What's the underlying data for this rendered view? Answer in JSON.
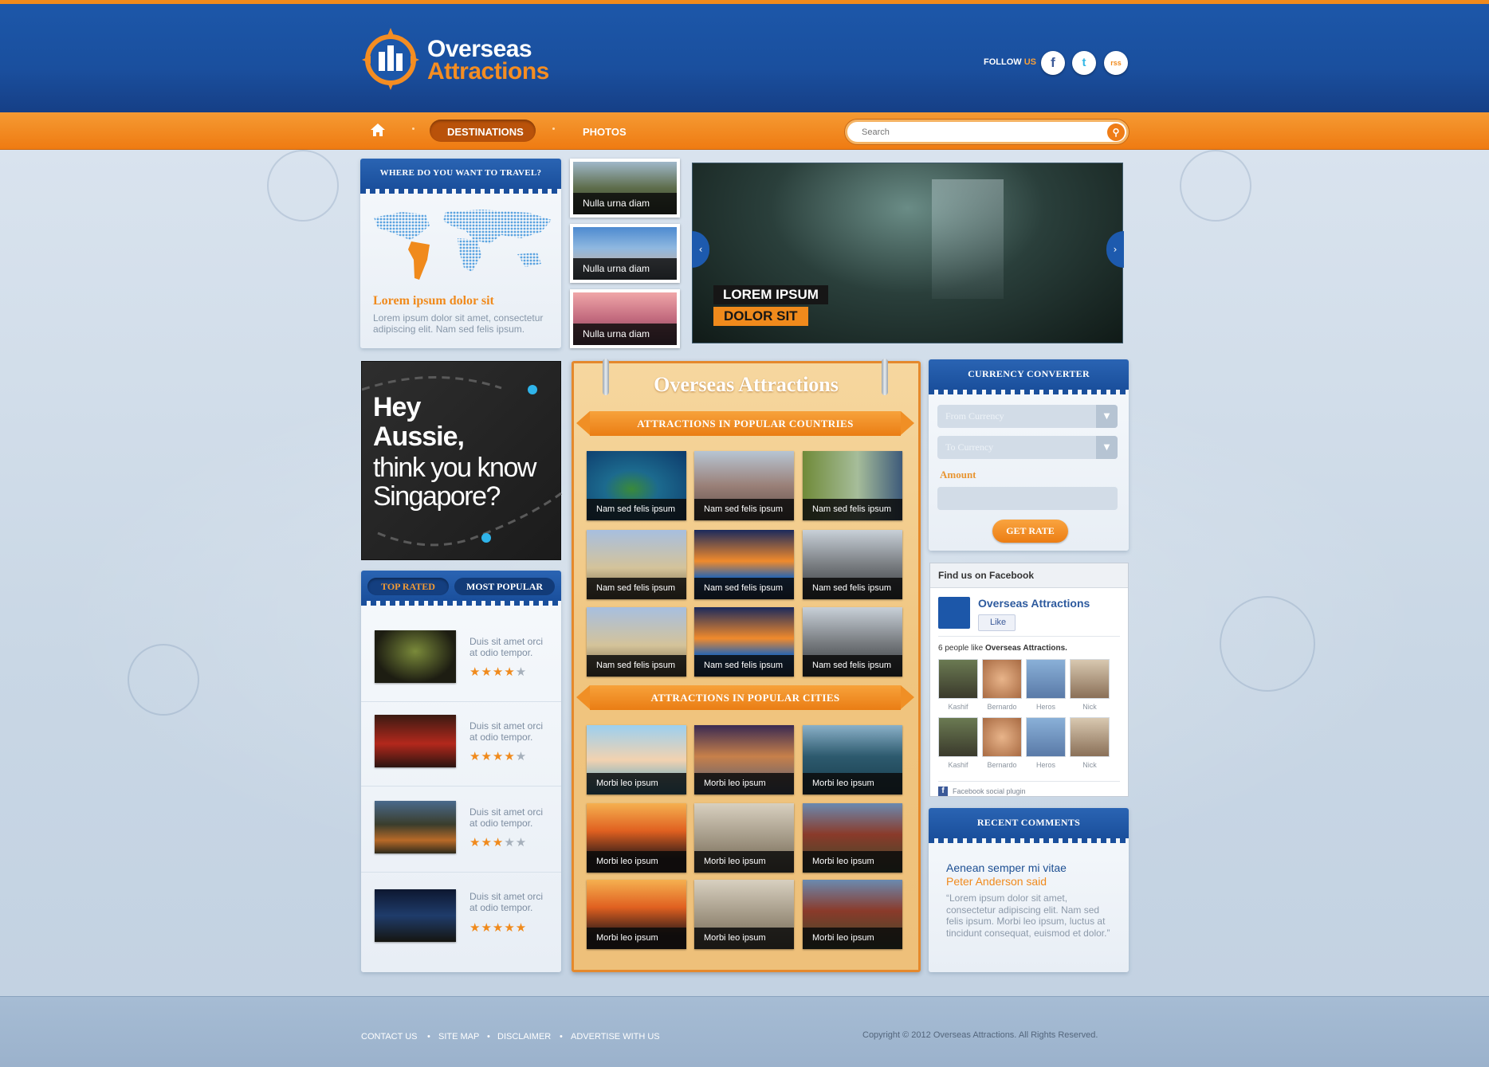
{
  "header": {
    "logo_line1": "Overseas",
    "logo_line2": "Attractions",
    "follow_prefix": "FOLLOW",
    "follow_suffix": "US",
    "social": [
      "f",
      "t",
      "rss"
    ]
  },
  "nav": {
    "home_icon": "home-icon",
    "items": [
      {
        "label": "DESTINATIONS",
        "active": true
      },
      {
        "label": "PHOTOS",
        "active": false
      }
    ],
    "search_placeholder": "Search"
  },
  "travel_panel": {
    "heading": "WHERE DO YOU WANT TO TRAVEL?",
    "title": "Lorem ipsum dolor sit",
    "text": "Lorem ipsum dolor sit amet, consectetur adipiscing elit. Nam sed felis ipsum."
  },
  "thumbs": [
    "Nulla urna diam",
    "Nulla urna diam",
    "Nulla urna diam"
  ],
  "slider": {
    "line1": "LOREM IPSUM",
    "line2": "DOLOR SIT"
  },
  "ad": {
    "line1": "Hey",
    "line2": "Aussie,",
    "line3": "think you know",
    "line4": "Singapore?"
  },
  "tabs": {
    "top_rated": "TOP RATED",
    "most_popular": "MOST POPULAR"
  },
  "rated_items": [
    {
      "text": "Duis sit amet orci at odio tempor.",
      "rating": 4
    },
    {
      "text": "Duis sit amet orci at odio tempor.",
      "rating": 4
    },
    {
      "text": "Duis sit amet orci at odio tempor.",
      "rating": 3
    },
    {
      "text": "Duis sit amet orci at odio tempor.",
      "rating": 5
    }
  ],
  "center": {
    "title": "Overseas Attractions",
    "countries_heading": "ATTRACTIONS IN POPULAR COUNTRIES",
    "countries_caption": "Nam sed felis ipsum",
    "cities_heading": "ATTRACTIONS IN POPULAR CITIES",
    "cities_caption": "Morbi leo ipsum"
  },
  "currency": {
    "heading": "CURRENCY CONVERTER",
    "from_label": "From Currency",
    "to_label": "To Currency",
    "amount_label": "Amount",
    "button": "GET RATE"
  },
  "facebook": {
    "heading": "Find us on Facebook",
    "page_name": "Overseas Attractions",
    "like": "Like",
    "count_prefix": "6 people like",
    "count_page": "Overseas Attractions.",
    "people": [
      "Kashif",
      "Bernardo",
      "Heros",
      "Nick",
      "Kashif",
      "Bernardo",
      "Heros",
      "Nick"
    ],
    "plugin": "Facebook social plugin"
  },
  "comments": {
    "heading": "RECENT COMMENTS",
    "title": "Aenean semper mi vitae",
    "author": "Peter Anderson said",
    "text": "“Lorem ipsum dolor sit amet, consectetur adipiscing elit. Nam sed felis ipsum. Morbi leo ipsum, luctus at tincidunt consequat, euismod et dolor.”"
  },
  "footer": {
    "links": [
      "CONTACT US",
      "SITE MAP",
      "DISCLAIMER",
      "ADVERTISE WITH US"
    ],
    "copyright": "Copyright © 2012 Overseas Attractions. All Rights Reserved."
  },
  "colors": {
    "orange": "#f08a1c",
    "blue": "#1c57a9"
  }
}
